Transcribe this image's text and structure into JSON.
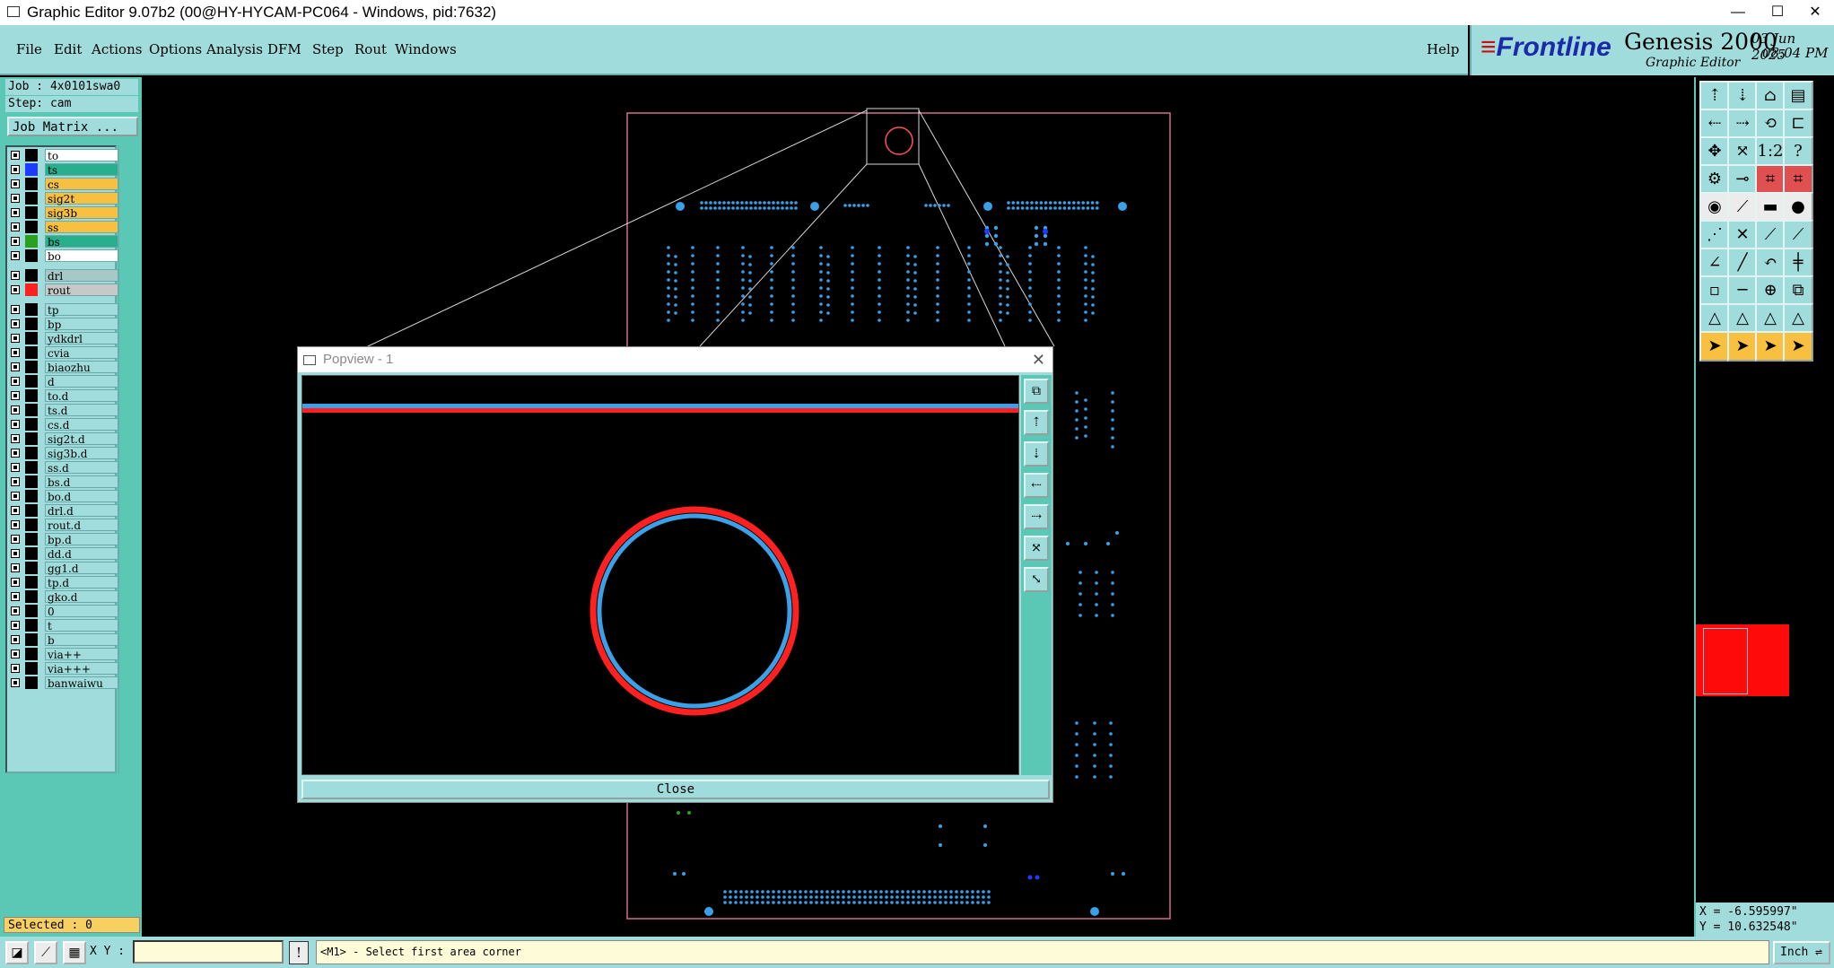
{
  "window": {
    "title": "Graphic Editor 9.07b2 (00@HY-HYCAM-PC064 - Windows, pid:7632)",
    "minimize": "—",
    "maximize": "☐",
    "close": "✕"
  },
  "menubar": {
    "items": [
      "File",
      "Edit",
      "Actions",
      "Options",
      "Analysis",
      "DFM",
      "Step",
      "Rout",
      "Windows"
    ],
    "help": "Help"
  },
  "brand": {
    "logo": "Frontline",
    "product": "Genesis 2000",
    "subtitle": "Graphic Editor",
    "date": "03 Jun 2025",
    "time": "08:04 PM"
  },
  "job": {
    "job_label": "Job : 4x0101swa0",
    "step_label": "Step: cam",
    "job_matrix_button": "Job Matrix ..."
  },
  "layers": [
    {
      "name": "to",
      "color": "#000000",
      "bg": "#ffffff"
    },
    {
      "name": "ts",
      "color": "#1e3cff",
      "bg": "#28b08c"
    },
    {
      "name": "cs",
      "color": "#000000",
      "bg": "#f8c040"
    },
    {
      "name": "sig2t",
      "color": "#000000",
      "bg": "#f8c040"
    },
    {
      "name": "sig3b",
      "color": "#000000",
      "bg": "#f8c040"
    },
    {
      "name": "ss",
      "color": "#000000",
      "bg": "#f8c040"
    },
    {
      "name": "bs",
      "color": "#2aa020",
      "bg": "#28b08c"
    },
    {
      "name": "bo",
      "color": "#000000",
      "bg": "#ffffff"
    },
    {
      "name": "drl",
      "color": "#000000",
      "bg": "#a8c8c8"
    },
    {
      "name": "rout",
      "color": "#ff2020",
      "bg": "#c8c8c8"
    },
    {
      "name": "tp",
      "color": "#000000",
      "bg": "#a0dcdc"
    },
    {
      "name": "bp",
      "color": "#000000",
      "bg": "#a0dcdc"
    },
    {
      "name": "ydkdrl",
      "color": "#000000",
      "bg": "#a0dcdc"
    },
    {
      "name": "cvia",
      "color": "#000000",
      "bg": "#a0dcdc"
    },
    {
      "name": "biaozhu",
      "color": "#000000",
      "bg": "#a0dcdc"
    },
    {
      "name": "d",
      "color": "#000000",
      "bg": "#a0dcdc"
    },
    {
      "name": "to.d",
      "color": "#000000",
      "bg": "#a0dcdc"
    },
    {
      "name": "ts.d",
      "color": "#000000",
      "bg": "#a0dcdc"
    },
    {
      "name": "cs.d",
      "color": "#000000",
      "bg": "#a0dcdc"
    },
    {
      "name": "sig2t.d",
      "color": "#000000",
      "bg": "#a0dcdc"
    },
    {
      "name": "sig3b.d",
      "color": "#000000",
      "bg": "#a0dcdc"
    },
    {
      "name": "ss.d",
      "color": "#000000",
      "bg": "#a0dcdc"
    },
    {
      "name": "bs.d",
      "color": "#000000",
      "bg": "#a0dcdc"
    },
    {
      "name": "bo.d",
      "color": "#000000",
      "bg": "#a0dcdc"
    },
    {
      "name": "drl.d",
      "color": "#000000",
      "bg": "#a0dcdc"
    },
    {
      "name": "rout.d",
      "color": "#000000",
      "bg": "#a0dcdc"
    },
    {
      "name": "bp.d",
      "color": "#000000",
      "bg": "#a0dcdc"
    },
    {
      "name": "dd.d",
      "color": "#000000",
      "bg": "#a0dcdc"
    },
    {
      "name": "gg1.d",
      "color": "#000000",
      "bg": "#a0dcdc"
    },
    {
      "name": "tp.d",
      "color": "#000000",
      "bg": "#a0dcdc"
    },
    {
      "name": "gko.d",
      "color": "#000000",
      "bg": "#a0dcdc"
    },
    {
      "name": "0",
      "color": "#000000",
      "bg": "#a0dcdc"
    },
    {
      "name": "t",
      "color": "#000000",
      "bg": "#a0dcdc"
    },
    {
      "name": "b",
      "color": "#000000",
      "bg": "#a0dcdc"
    },
    {
      "name": "via++",
      "color": "#000000",
      "bg": "#a0dcdc"
    },
    {
      "name": "via+++",
      "color": "#000000",
      "bg": "#a0dcdc"
    },
    {
      "name": "banwaiwu",
      "color": "#000000",
      "bg": "#a0dcdc"
    }
  ],
  "selected": "Selected : 0",
  "coords": {
    "x": "X = -6.595997\"",
    "y": "Y = 10.632548\""
  },
  "statusbar": {
    "xy_label": "X Y :",
    "xy_value": "",
    "bang": "!",
    "prompt": "<M1> - Select first area corner",
    "unit": "Inch"
  },
  "popview": {
    "title": "Popview - 1",
    "close_x": "✕",
    "close_button": "Close"
  },
  "colors": {
    "panel": "#a0dcdc",
    "pad_blue": "#3aa0e8",
    "rout_red": "#ff2020",
    "board_outline": "#d07090"
  }
}
